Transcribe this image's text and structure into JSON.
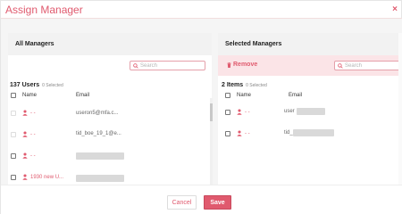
{
  "dialog": {
    "title": "Assign Manager",
    "close_label": "×"
  },
  "left": {
    "header": "All Managers",
    "search_placeholder": "Search",
    "count_label": "137 Users",
    "selected_label": "0 Selected",
    "columns": {
      "name": "Name",
      "email": "Email"
    },
    "rows": [
      {
        "name": "- -",
        "email": "useron5@mfa.c...",
        "checkbox": "disabled"
      },
      {
        "name": "- -",
        "email": "tid_boe_19_1@e...",
        "checkbox": "disabled"
      },
      {
        "name": "- -",
        "email": "",
        "checkbox": "enabled"
      },
      {
        "name": "1930 new U...",
        "email": "",
        "checkbox": "enabled"
      }
    ]
  },
  "right": {
    "header": "Selected Managers",
    "remove_label": "Remove",
    "search_placeholder": "Search",
    "count_label": "2 Items",
    "selected_label": "0 Selected",
    "columns": {
      "name": "Name",
      "email": "Email"
    },
    "rows": [
      {
        "name": "- -",
        "email": "user"
      },
      {
        "name": "- -",
        "email": "tid_"
      }
    ]
  },
  "footer": {
    "cancel_label": "Cancel",
    "save_label": "Save"
  },
  "colors": {
    "accent": "#e05a6e",
    "panel_bg": "#f5f5f5",
    "toolbar_pink": "#fbe4e7"
  },
  "icons": {
    "user": "user-icon",
    "search": "search-icon",
    "trash": "trash-icon",
    "close": "close-icon"
  }
}
